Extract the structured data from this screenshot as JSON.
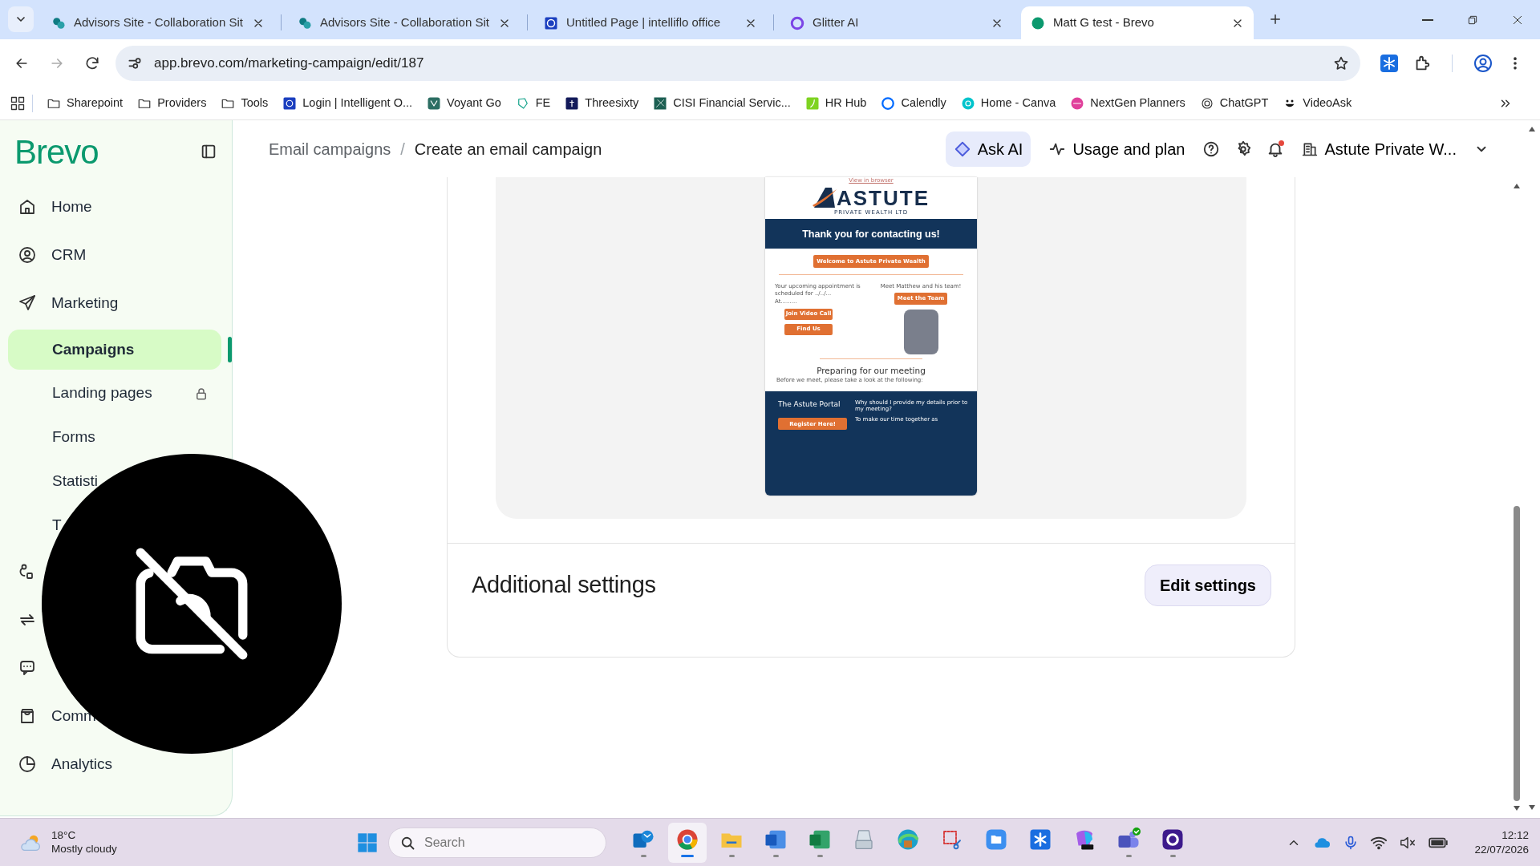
{
  "browser": {
    "tabs": [
      {
        "title": "Advisors Site - Collaboration Sit",
        "selected": false
      },
      {
        "title": "Advisors Site - Collaboration Sit",
        "selected": false
      },
      {
        "title": "Untitled Page | intelliflo office",
        "selected": false
      },
      {
        "title": "Glitter AI",
        "selected": false
      },
      {
        "title": "Matt G test - Brevo",
        "selected": true
      }
    ],
    "url": "app.brevo.com/marketing-campaign/edit/187",
    "bookmarks": [
      "Sharepoint",
      "Providers",
      "Tools",
      "Login | Intelligent O...",
      "Voyant Go",
      "FE",
      "Threesixty",
      "CISI Financial Servic...",
      "HR Hub",
      "Calendly",
      "Home - Canva",
      "NextGen Planners",
      "ChatGPT",
      "VideoAsk"
    ]
  },
  "sidebar": {
    "logo": "Brevo",
    "items": [
      {
        "label": "Home",
        "kind": "section",
        "selected": false,
        "locked": false
      },
      {
        "label": "CRM",
        "kind": "section",
        "selected": false,
        "locked": false
      },
      {
        "label": "Marketing",
        "kind": "section",
        "selected": false,
        "locked": false
      },
      {
        "label": "Campaigns",
        "kind": "sub",
        "selected": true,
        "locked": false
      },
      {
        "label": "Landing pages",
        "kind": "sub",
        "selected": false,
        "locked": true
      },
      {
        "label": "Forms",
        "kind": "sub",
        "selected": false,
        "locked": false
      },
      {
        "label": "Statisti",
        "kind": "sub",
        "selected": false
      },
      {
        "label": "T",
        "kind": "sub",
        "selected": false
      },
      {
        "kind": "section",
        "selected": false
      },
      {
        "kind": "section",
        "selected": false
      },
      {
        "kind": "section",
        "selected": false
      },
      {
        "label": "Comm",
        "kind": "section",
        "selected": false
      },
      {
        "label": "Analytics",
        "kind": "section",
        "selected": false,
        "locked": false
      }
    ]
  },
  "header": {
    "breadcrumb": [
      "Email campaigns",
      "Create an email campaign"
    ],
    "separator": "/",
    "ask_ai": "Ask AI",
    "usage": "Usage and plan",
    "account": "Astute Private W...",
    "unread_notifications": true
  },
  "email_preview": {
    "view_link": "View in browser",
    "logo": "ASTUTE",
    "logo_sub": "PRIVATE WEALTH LTD",
    "banner": "Thank you for contacting us!",
    "welcome_button": "Welcome to Astute Private Wealth",
    "appointment": "Your upcoming appointment is scheduled for ../../...",
    "at": "At.........",
    "video_button": "Join Video Call",
    "find_button": "Find Us",
    "meet_text": "Meet Matthew and his team!",
    "meet_button": "Meet the Team",
    "heading": "Preparing for our meeting",
    "intro": "Before we meet, please take a look at the following:",
    "portal_title": "The Astute Portal",
    "register_button": "Register Here!",
    "why_title": "Why should I provide my details prior to my meeting?",
    "why_text": "To make our time together as"
  },
  "settings": {
    "title": "Additional settings",
    "button": "Edit settings"
  },
  "camera_off_overlay": true,
  "taskbar": {
    "temperature": "18°C",
    "weather": "Mostly cloudy",
    "search_placeholder": "Search",
    "apps": [
      {
        "running": true,
        "selected": false
      },
      {
        "running": true,
        "selected": true
      },
      {
        "running": true,
        "selected": false
      },
      {
        "running": true,
        "selected": false
      },
      {
        "running": true,
        "selected": false
      },
      {
        "running": false,
        "selected": false
      },
      {
        "running": false,
        "selected": false
      },
      {
        "running": false,
        "selected": false
      },
      {
        "running": false,
        "selected": false
      },
      {
        "running": false,
        "selected": false
      },
      {
        "running": false,
        "selected": false
      },
      {
        "running": true,
        "selected": false
      },
      {
        "running": true,
        "selected": false
      }
    ],
    "time": "12:12",
    "date": "22/07/2026"
  }
}
